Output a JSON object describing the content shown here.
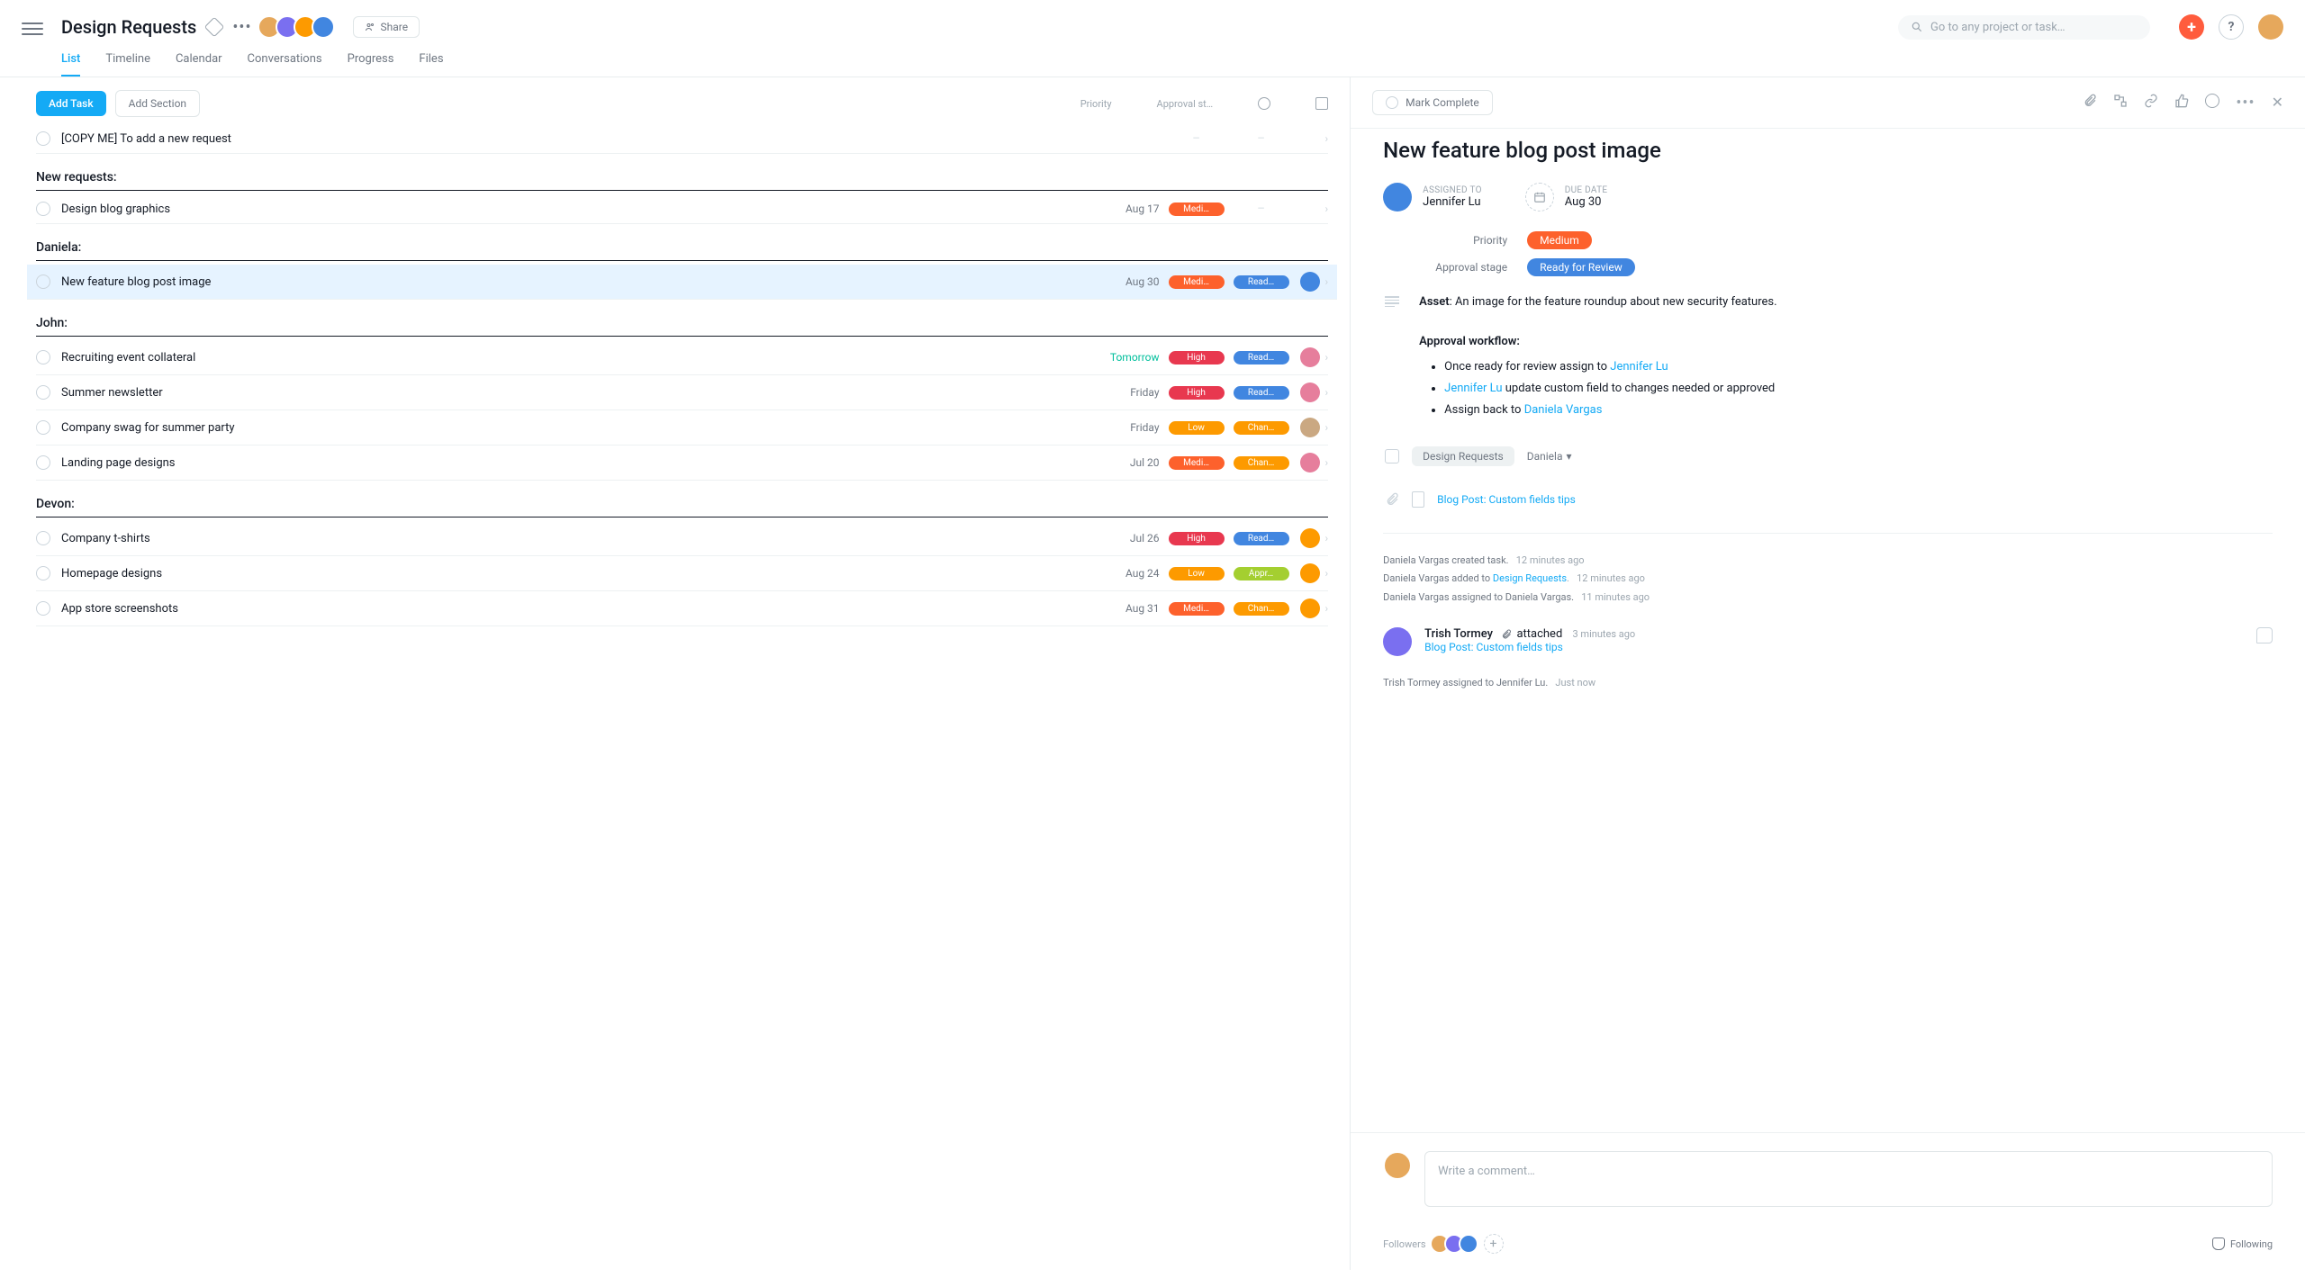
{
  "header": {
    "project_title": "Design Requests",
    "share_label": "Share",
    "search_placeholder": "Go to any project or task…",
    "tabs": [
      "List",
      "Timeline",
      "Calendar",
      "Conversations",
      "Progress",
      "Files"
    ],
    "active_tab": "List"
  },
  "toolbar": {
    "add_task": "Add Task",
    "add_section": "Add Section",
    "col_priority": "Priority",
    "col_approval": "Approval st…"
  },
  "sections": [
    {
      "title": "",
      "tasks": [
        {
          "name": "[COPY ME] To add a new request",
          "date": "",
          "priority": "—",
          "approval": "—",
          "assignee": ""
        }
      ]
    },
    {
      "title": "New requests:",
      "tasks": [
        {
          "name": "Design blog graphics",
          "date": "Aug 17",
          "priority": "Medi…",
          "priority_class": "medium",
          "approval": "—",
          "approval_class": "empty",
          "assignee": ""
        }
      ]
    },
    {
      "title": "Daniela:",
      "tasks": [
        {
          "name": "New feature blog post image",
          "date": "Aug 30",
          "priority": "Medi…",
          "priority_class": "medium",
          "approval": "Read…",
          "approval_class": "ready",
          "assignee": "av-d",
          "selected": true
        }
      ]
    },
    {
      "title": "John:",
      "tasks": [
        {
          "name": "Recruiting event collateral",
          "date": "Tomorrow",
          "date_class": "green",
          "priority": "High",
          "priority_class": "high",
          "approval": "Read…",
          "approval_class": "ready",
          "assignee": "av-e"
        },
        {
          "name": "Summer newsletter",
          "date": "Friday",
          "priority": "High",
          "priority_class": "high",
          "approval": "Read…",
          "approval_class": "ready",
          "assignee": "av-e"
        },
        {
          "name": "Company swag for summer party",
          "date": "Friday",
          "priority": "Low",
          "priority_class": "low",
          "approval": "Chan…",
          "approval_class": "changes",
          "assignee": "av-f"
        },
        {
          "name": "Landing page designs",
          "date": "Jul 20",
          "priority": "Medi…",
          "priority_class": "medium",
          "approval": "Chan…",
          "approval_class": "changes",
          "assignee": "av-e"
        }
      ]
    },
    {
      "title": "Devon:",
      "tasks": [
        {
          "name": "Company t-shirts",
          "date": "Jul 26",
          "priority": "High",
          "priority_class": "high",
          "approval": "Read…",
          "approval_class": "ready",
          "assignee": "av-c"
        },
        {
          "name": "Homepage designs",
          "date": "Aug 24",
          "priority": "Low",
          "priority_class": "low",
          "approval": "Appr…",
          "approval_class": "approved",
          "assignee": "av-c"
        },
        {
          "name": "App store screenshots",
          "date": "Aug 31",
          "priority": "Medi…",
          "priority_class": "medium",
          "approval": "Chan…",
          "approval_class": "changes",
          "assignee": "av-c"
        }
      ]
    }
  ],
  "detail": {
    "mark_complete": "Mark Complete",
    "title": "New feature blog post image",
    "assigned_label": "ASSIGNED TO",
    "assigned_value": "Jennifer Lu",
    "due_label": "DUE DATE",
    "due_value": "Aug 30",
    "priority_label": "Priority",
    "priority_value": "Medium",
    "approval_label": "Approval stage",
    "approval_value": "Ready for Review",
    "asset_label": "Asset",
    "asset_text": ": An image for the feature roundup about new security features.",
    "workflow_heading": "Approval workflow:",
    "workflow_item1_a": "Once ready for review assign to ",
    "workflow_item1_link": "Jennifer Lu",
    "workflow_item2_link": "Jennifer Lu",
    "workflow_item2_b": " update custom field to changes needed or approved",
    "workflow_item3_a": "Assign back to ",
    "workflow_item3_link": "Daniela Vargas",
    "project_chip": "Design Requests",
    "project_section": "Daniela",
    "attachment_name": "Blog Post: Custom fields tips",
    "history": [
      {
        "text": "Daniela Vargas created task.",
        "time": "12 minutes ago"
      },
      {
        "text": "Daniela Vargas added to ",
        "link": "Design Requests",
        "tail": ".",
        "time": "12 minutes ago"
      },
      {
        "text": "Daniela Vargas assigned to Daniela Vargas.",
        "time": "11 minutes ago"
      }
    ],
    "activity_name": "Trish Tormey",
    "activity_verb": "attached",
    "activity_time": "3 minutes ago",
    "activity_link": "Blog Post: Custom fields tips",
    "history2": {
      "text": "Trish Tormey assigned to Jennifer Lu.",
      "time": "Just now"
    },
    "comment_placeholder": "Write a comment…",
    "followers_label": "Followers",
    "following_label": "Following"
  }
}
